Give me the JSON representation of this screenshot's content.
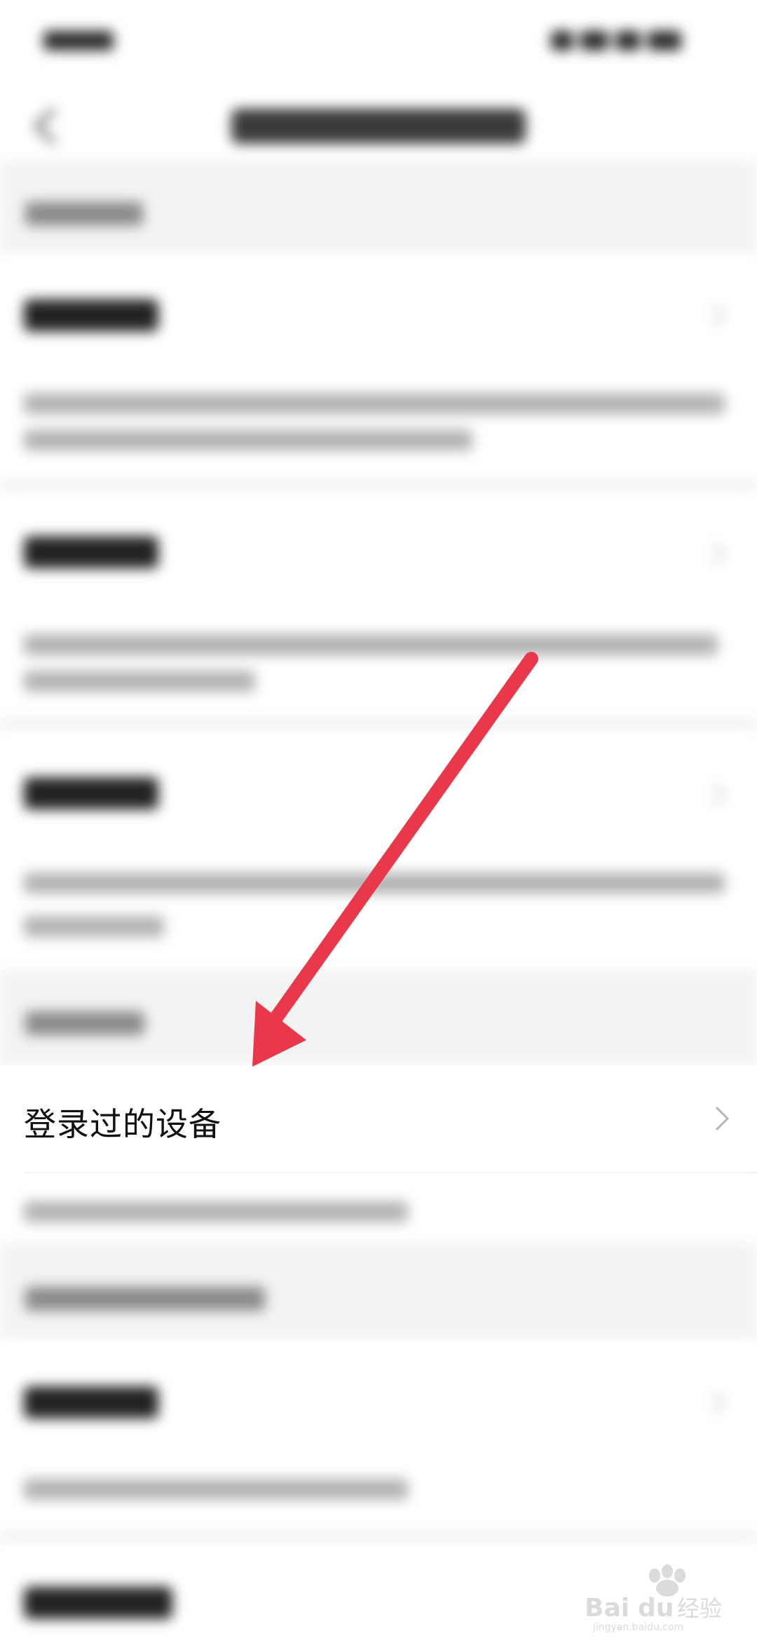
{
  "devices_row": {
    "label": "登录过的设备"
  },
  "watermark": {
    "text": "Bai du 经验",
    "subtext": "jingyan.baidu.com"
  },
  "colors": {
    "arrow": "#e8384a",
    "section_bg": "#f3f3f3"
  }
}
